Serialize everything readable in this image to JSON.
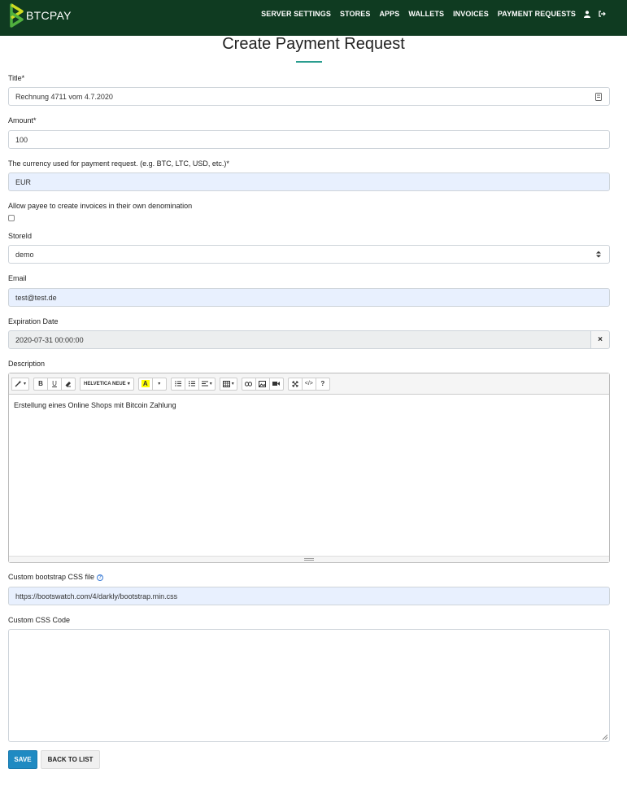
{
  "brand": {
    "name": "BTCPAY",
    "logo_color": "#51b13e"
  },
  "nav": {
    "items": [
      {
        "label": "SERVER SETTINGS"
      },
      {
        "label": "STORES"
      },
      {
        "label": "APPS"
      },
      {
        "label": "WALLETS"
      },
      {
        "label": "INVOICES"
      },
      {
        "label": "PAYMENT REQUESTS"
      }
    ],
    "icons": [
      "user-icon",
      "sign-out-icon"
    ],
    "background": "#0f3b21"
  },
  "page": {
    "title": "Create Payment Request",
    "accent": "#2a9d8f"
  },
  "form": {
    "title": {
      "label": "Title*",
      "value": "Rechnung 4711 vom 4.7.2020"
    },
    "amount": {
      "label": "Amount*",
      "value": "100"
    },
    "currency": {
      "label": "The currency used for payment request. (e.g. BTC, LTC, USD, etc.)*",
      "value": "EUR"
    },
    "allow_custom": {
      "label": "Allow payee to create invoices in their own denomination",
      "checked": false
    },
    "store": {
      "label": "StoreId",
      "value": "demo"
    },
    "email": {
      "label": "Email",
      "value": "test@test.de"
    },
    "expiration": {
      "label": "Expiration Date",
      "value": "2020-07-31 00:00:00",
      "clear": "×"
    },
    "description": {
      "label": "Description",
      "font_name": "HELVETICA NEUE",
      "content": "Erstellung eines Online Shops mit Bitcoin Zahlung"
    },
    "custom_css_file": {
      "label": "Custom bootstrap CSS file",
      "value": "https://bootswatch.com/4/darkly/bootstrap.min.css"
    },
    "custom_css_code": {
      "label": "Custom CSS Code",
      "value": ""
    }
  },
  "buttons": {
    "save": "SAVE",
    "back": "BACK TO LIST",
    "save_color": "#1f8ac2"
  }
}
